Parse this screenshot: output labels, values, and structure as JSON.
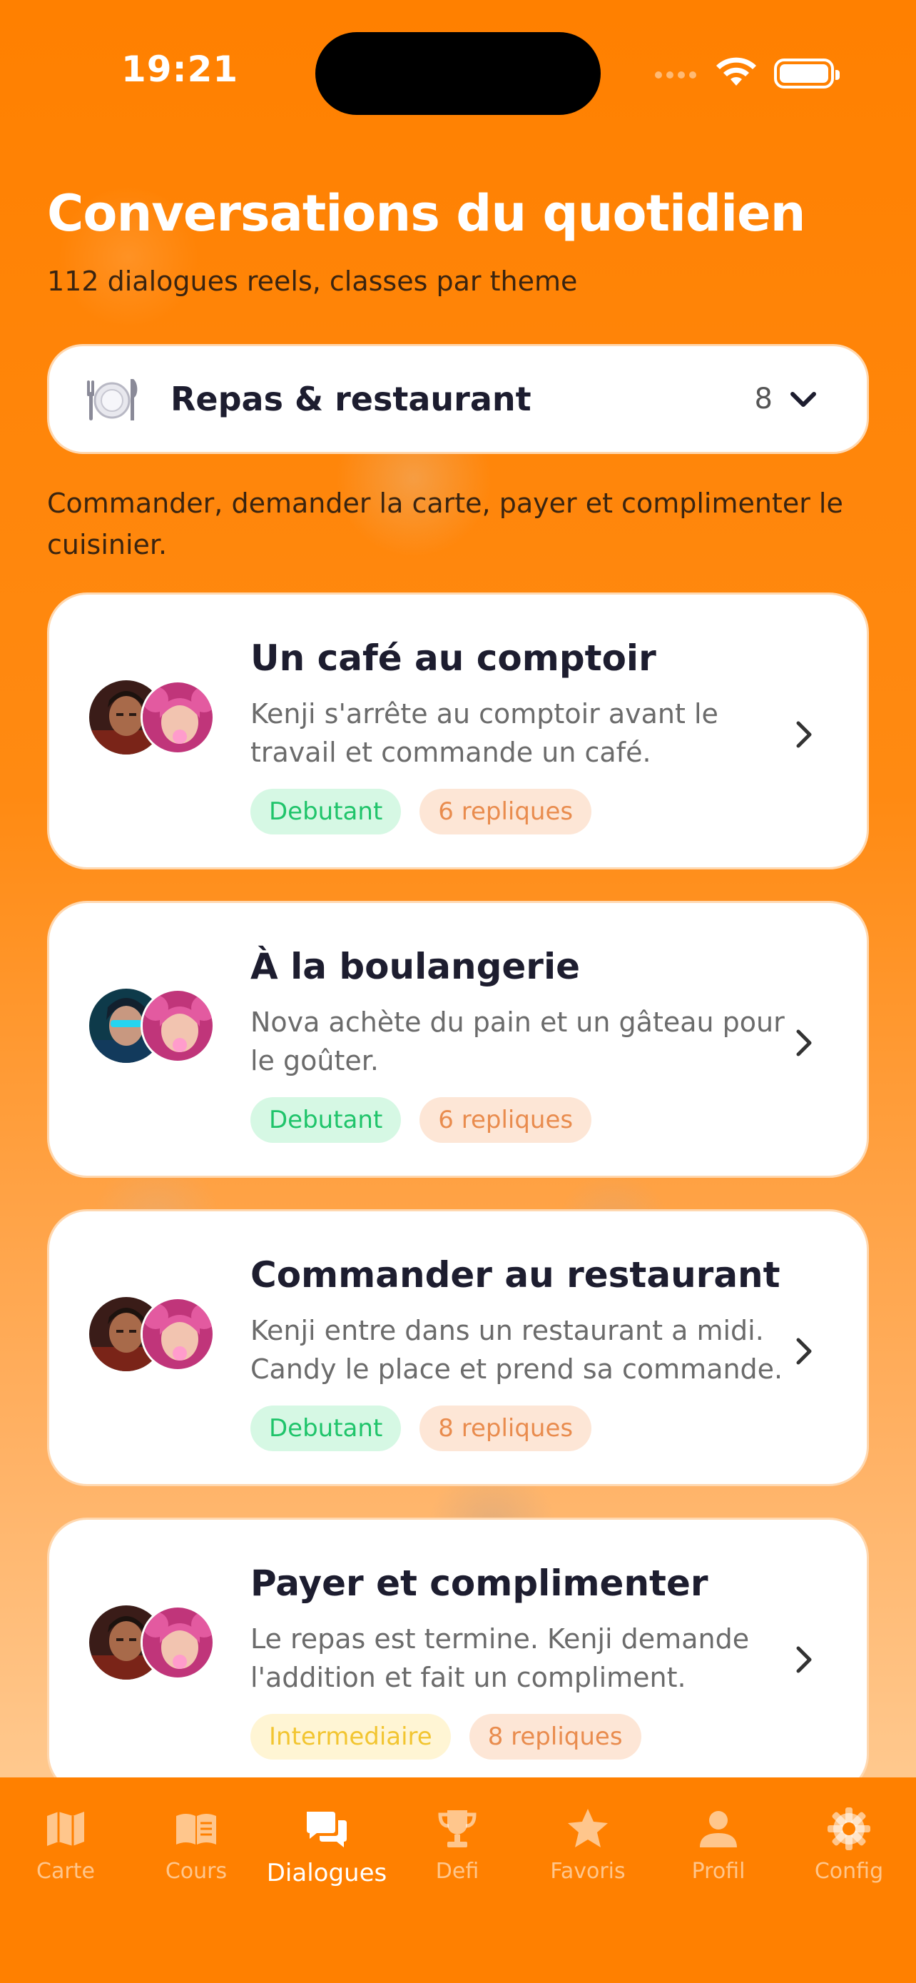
{
  "status_bar": {
    "time": "19:21"
  },
  "header": {
    "title": "Conversations du quotidien",
    "subtitle": "112 dialogues reels, classes par theme"
  },
  "category": {
    "icon": "plate-cutlery-icon",
    "label": "Repas & restaurant",
    "count": "8",
    "description": "Commander, demander la carte, payer et complimenter le cuisinier."
  },
  "dialogues": [
    {
      "title": "Un café au comptoir",
      "description": "Kenji s'arrête au comptoir avant le travail et commande un café.",
      "level": "Debutant",
      "replies": "6 repliques"
    },
    {
      "title": "À la boulangerie",
      "description": "Nova achète du pain et un gâteau pour le goûter.",
      "level": "Debutant",
      "replies": "6 repliques"
    },
    {
      "title": "Commander au restaurant",
      "description": "Kenji entre dans un restaurant a midi. Candy le place et prend sa commande.",
      "level": "Debutant",
      "replies": "8 repliques"
    },
    {
      "title": "Payer et complimenter",
      "description": "Le repas est termine. Kenji demande l'addition et fait un compliment.",
      "level": "Intermediaire",
      "replies": "8 repliques"
    }
  ],
  "nav": [
    {
      "label": "Carte",
      "icon": "map-icon"
    },
    {
      "label": "Cours",
      "icon": "book-icon"
    },
    {
      "label": "Dialogues",
      "icon": "chat-bubbles-icon",
      "active": true
    },
    {
      "label": "Defi",
      "icon": "trophy-icon"
    },
    {
      "label": "Favoris",
      "icon": "star-icon"
    },
    {
      "label": "Profil",
      "icon": "person-icon"
    },
    {
      "label": "Config",
      "icon": "gear-icon"
    }
  ],
  "colors": {
    "brand": "#ff8000",
    "level_beginner": "#1fc46a",
    "level_intermediate": "#f2c531",
    "replies": "#e98c4e"
  }
}
